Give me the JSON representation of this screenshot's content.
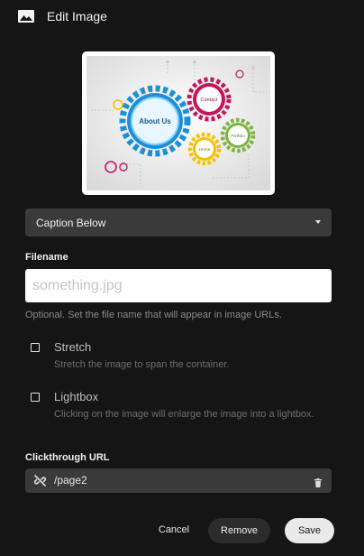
{
  "header": {
    "title": "Edit Image",
    "icon": "image-icon"
  },
  "thumbnail": {
    "gear_labels": {
      "main": "About Us",
      "contact": "Contact",
      "portfolio": "Portfolio",
      "home": "Home"
    },
    "colors": {
      "blue": "#1e8fd6",
      "pink": "#c2185b",
      "green": "#7cb342",
      "yellow": "#f2c200"
    }
  },
  "caption_select": {
    "selected": "Caption Below"
  },
  "filename": {
    "label": "Filename",
    "placeholder": "something.jpg",
    "help": "Optional. Set the file name that will appear in image URLs."
  },
  "options": {
    "stretch": {
      "title": "Stretch",
      "description": "Stretch the image to span the container.",
      "checked": false
    },
    "lightbox": {
      "title": "Lightbox",
      "description": "Clicking on the image will enlarge the image into a lightbox.",
      "checked": false
    }
  },
  "clickthrough": {
    "label": "Clickthrough URL",
    "value": "/page2",
    "icon": "unlink-icon"
  },
  "footer": {
    "cancel": "Cancel",
    "remove": "Remove",
    "save": "Save"
  },
  "colors": {
    "background": "#151515",
    "field": "#3a3a3a",
    "save_button": "#e9e9e9"
  }
}
